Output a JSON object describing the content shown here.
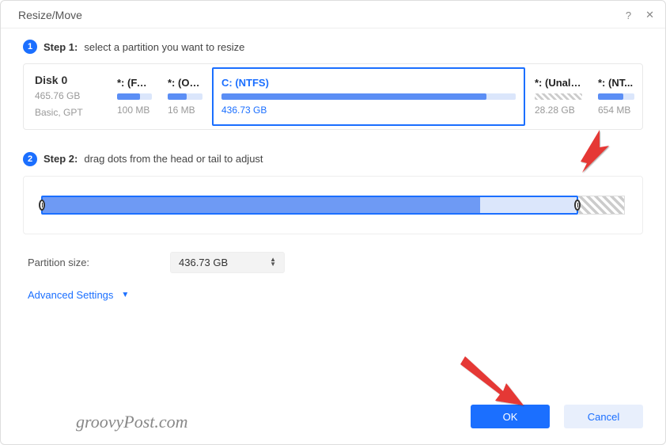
{
  "title": "Resize/Move",
  "step1": {
    "num": "1",
    "label": "Step 1:",
    "text": "select a partition you want to resize"
  },
  "disk": {
    "name": "Disk 0",
    "size": "465.76 GB",
    "type": "Basic, GPT"
  },
  "partitions": [
    {
      "label": "*: (FAT...",
      "size": "100 MB",
      "fill_pct": 65
    },
    {
      "label": "*: (Oth...",
      "size": "16 MB",
      "fill_pct": 55
    },
    {
      "label": "C: (NTFS)",
      "size": "436.73 GB",
      "fill_pct": 90,
      "selected": true
    },
    {
      "label": "*: (Unallo...",
      "size": "28.28 GB",
      "unalloc": true
    },
    {
      "label": "*: (NT...",
      "size": "654 MB",
      "fill_pct": 70
    }
  ],
  "step2": {
    "num": "2",
    "label": "Step 2:",
    "text": "drag dots from the head or tail to adjust"
  },
  "size_row": {
    "label": "Partition size:",
    "value": "436.73 GB"
  },
  "advanced": "Advanced Settings",
  "buttons": {
    "ok": "OK",
    "cancel": "Cancel"
  },
  "watermark": "groovyPost.com"
}
